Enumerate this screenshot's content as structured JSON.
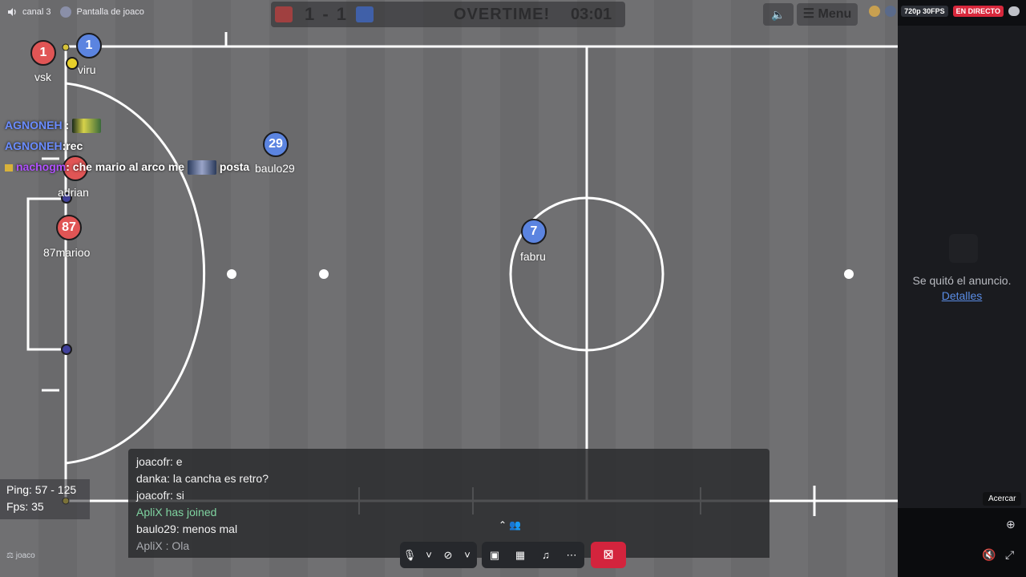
{
  "topbar": {
    "channel_name": "canal 3",
    "screen_name": "Pantalla de joaco",
    "quality": "720p 30FPS",
    "live_badge": "EN DIRECTO",
    "colors": {
      "live": "#d8283c"
    }
  },
  "scoreboard": {
    "score": "1 - 1",
    "status": "OVERTIME!",
    "timer": "03:01",
    "menu_label": "☰ Menu",
    "red_color": "#a04040",
    "blue_color": "#4060a8"
  },
  "players": [
    {
      "number": "1",
      "name": "vsk",
      "team": "red"
    },
    {
      "number": "1",
      "name": "viru",
      "team": "blue"
    },
    {
      "number": "29",
      "name": "baulo29",
      "team": "blue"
    },
    {
      "number": "87",
      "name": "87marioo",
      "team": "red"
    },
    {
      "number": "7",
      "name": "fabru",
      "team": "blue"
    },
    {
      "number": "",
      "name": "adrian",
      "team": "red"
    }
  ],
  "overlay_chat": [
    {
      "user": "AGNONEH",
      "text": ""
    },
    {
      "user": "AGNONEH",
      "text": ":rec"
    },
    {
      "user": "nachogm",
      "text": ": che mario al arco me",
      "suffix": "posta"
    }
  ],
  "stats": {
    "ping": "Ping: 57 - 125",
    "fps": "Fps: 35"
  },
  "chat": {
    "lines": [
      {
        "text": "joacofr: e",
        "kind": "normal"
      },
      {
        "text": "danka: la cancha es retro?",
        "kind": "normal"
      },
      {
        "text": "joacofr: si",
        "kind": "normal"
      },
      {
        "text": "ApliX has joined",
        "kind": "join"
      },
      {
        "text": "baulo29: menos mal",
        "kind": "normal"
      },
      {
        "text": "ApliX : Ola",
        "kind": "dim"
      }
    ]
  },
  "controls": {
    "mic_icon": "microphone-icon",
    "camera_icon": "camera-off-icon",
    "share_icon": "screen-share-icon",
    "activities_icon": "activities-icon",
    "effects_icon": "soundboard-icon",
    "more_icon": "more-icon",
    "end_icon": "end-stream-icon"
  },
  "side_panel": {
    "ad_text": "Se quitó el anuncio.",
    "ad_link": "Detalles",
    "tooltip": "Acercar"
  },
  "footer": {
    "user_tag": "joaco"
  }
}
